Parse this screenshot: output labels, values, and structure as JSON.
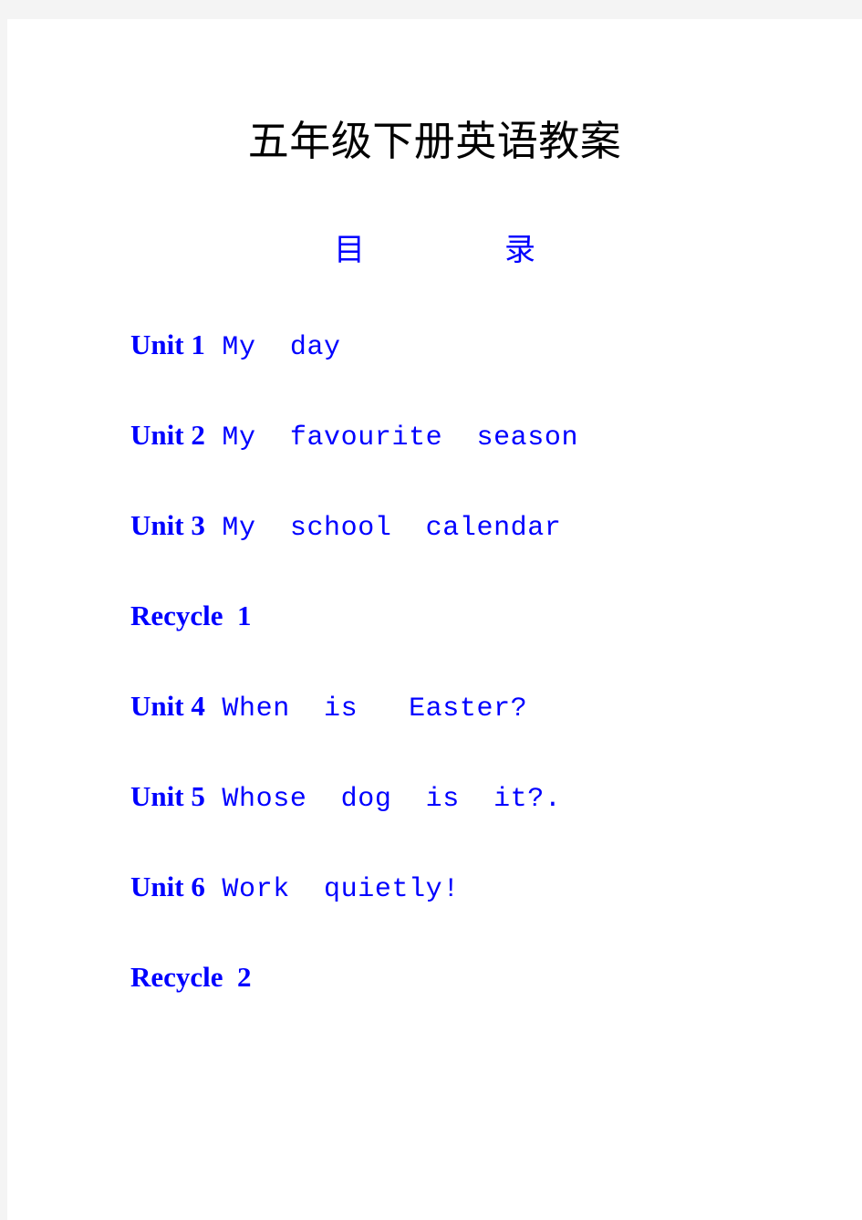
{
  "document": {
    "title": "五年级下册英语教案",
    "toc_heading": "目                  录",
    "page_background": "#ffffff",
    "margin_color": "#f4f4f4",
    "title_color": "#000000",
    "accent_color": "#0000ff"
  },
  "toc": {
    "entries": [
      {
        "label": "Unit 1",
        "text": " My  day"
      },
      {
        "label": "Unit 2",
        "text": " My  favourite  season"
      },
      {
        "label": "Unit 3",
        "text": " My  school  calendar"
      },
      {
        "label": "Recycle  1",
        "text": ""
      },
      {
        "label": "Unit 4",
        "text": " When  is   Easter?"
      },
      {
        "label": "Unit 5",
        "text": " Whose  dog  is  it?."
      },
      {
        "label": "Unit 6",
        "text": " Work  quietly!"
      },
      {
        "label": "Recycle  2",
        "text": ""
      }
    ]
  }
}
